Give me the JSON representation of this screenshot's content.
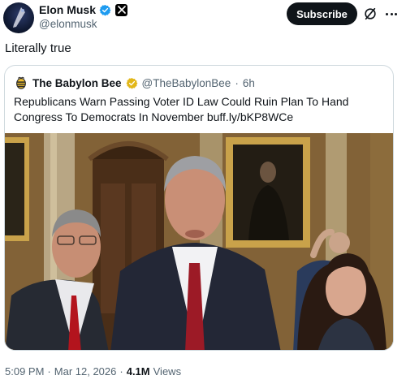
{
  "author": {
    "name": "Elon Musk",
    "handle": "@elonmusk"
  },
  "actions": {
    "subscribe_label": "Subscribe"
  },
  "post": {
    "text": "Literally true"
  },
  "quoted_post": {
    "name": "The Babylon Bee",
    "handle": "@TheBabylonBee",
    "separator": "·",
    "time": "6h",
    "text": "Republicans Warn Passing Voter ID Law Could Ruin Plan To Hand Congress To Democrats In November buff.ly/bKP8WCe"
  },
  "meta": {
    "time": "5:09 PM",
    "separator": "·",
    "date": "Mar 12, 2026",
    "separator2": "·",
    "views_count": "4.1M",
    "views_label": "Views"
  },
  "colors": {
    "verified_blue": "#1d9bf0",
    "verified_gold": "#e2b719",
    "subscribe_bg": "#0f1419",
    "secondary_text": "#536471"
  },
  "icons": [
    "verified-icon",
    "x-logo-icon",
    "grok-icon",
    "more-icon",
    "bee-logo-icon",
    "gold-verified-icon"
  ]
}
